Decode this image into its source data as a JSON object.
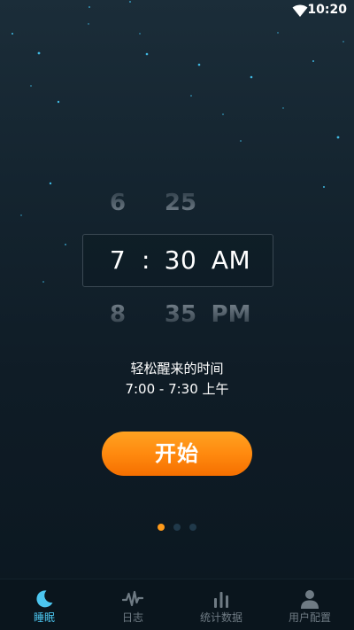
{
  "status_bar": {
    "time": "10:20",
    "icons": [
      "wifi-icon"
    ]
  },
  "picker": {
    "hour": {
      "prev": "6",
      "current": "7",
      "next": "8"
    },
    "separator": ":",
    "minute": {
      "prev": "25",
      "current": "30",
      "next": "35"
    },
    "period": {
      "prev": "",
      "current": "AM",
      "next": "PM"
    }
  },
  "caption": {
    "title": "轻松醒来的时间",
    "range": "7:00 - 7:30 上午"
  },
  "start_button": {
    "label": "开始"
  },
  "pager": {
    "count": 3,
    "active_index": 0
  },
  "tabbar": {
    "items": [
      {
        "label": "睡眠",
        "icon": "moon-icon",
        "active": true
      },
      {
        "label": "日志",
        "icon": "waveform-icon",
        "active": false
      },
      {
        "label": "统计数据",
        "icon": "bar-chart-icon",
        "active": false
      },
      {
        "label": "用户配置",
        "icon": "user-icon",
        "active": false
      }
    ]
  },
  "colors": {
    "accent": "#4cc6f0",
    "button": "#ff8a0f",
    "background": "#14242f",
    "pager_active": "#ff9a1a"
  }
}
